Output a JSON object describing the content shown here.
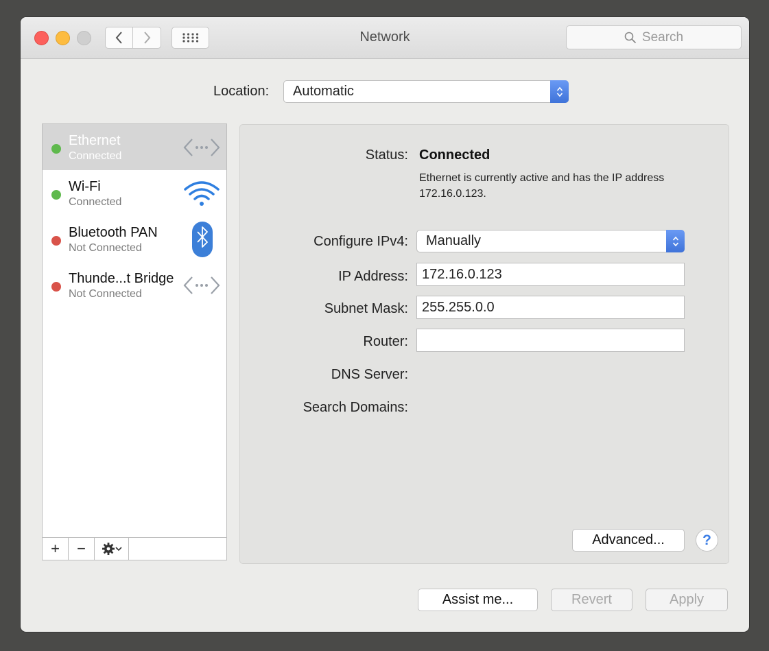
{
  "window": {
    "title": "Network"
  },
  "search": {
    "placeholder": "Search"
  },
  "location": {
    "label": "Location:",
    "value": "Automatic"
  },
  "services": [
    {
      "name": "Ethernet",
      "status": "Connected",
      "state": "connected",
      "icon": "ethernet-icon",
      "selected": true
    },
    {
      "name": "Wi-Fi",
      "status": "Connected",
      "state": "connected",
      "icon": "wifi-icon",
      "selected": false
    },
    {
      "name": "Bluetooth PAN",
      "status": "Not Connected",
      "state": "not-connected",
      "icon": "bluetooth-icon",
      "selected": false
    },
    {
      "name": "Thunde...t Bridge",
      "status": "Not Connected",
      "state": "not-connected",
      "icon": "thunderbolt-bridge-icon",
      "selected": false
    }
  ],
  "sidebar_buttons": {
    "add": "+",
    "remove": "−"
  },
  "detail": {
    "status_label": "Status:",
    "status_value": "Connected",
    "status_description": "Ethernet is currently active and has the IP address 172.16.0.123.",
    "configure_label": "Configure IPv4:",
    "configure_value": "Manually",
    "ip_label": "IP Address:",
    "ip_value": "172.16.0.123",
    "subnet_label": "Subnet Mask:",
    "subnet_value": "255.255.0.0",
    "router_label": "Router:",
    "router_value": "",
    "dns_label": "DNS Server:",
    "search_domains_label": "Search Domains:",
    "advanced_label": "Advanced...",
    "help_label": "?"
  },
  "footer": {
    "assist_label": "Assist me...",
    "revert_label": "Revert",
    "apply_label": "Apply"
  },
  "colors": {
    "connected": "#5fb94d",
    "not_connected": "#d9534a",
    "accent": "#3f73d9"
  }
}
